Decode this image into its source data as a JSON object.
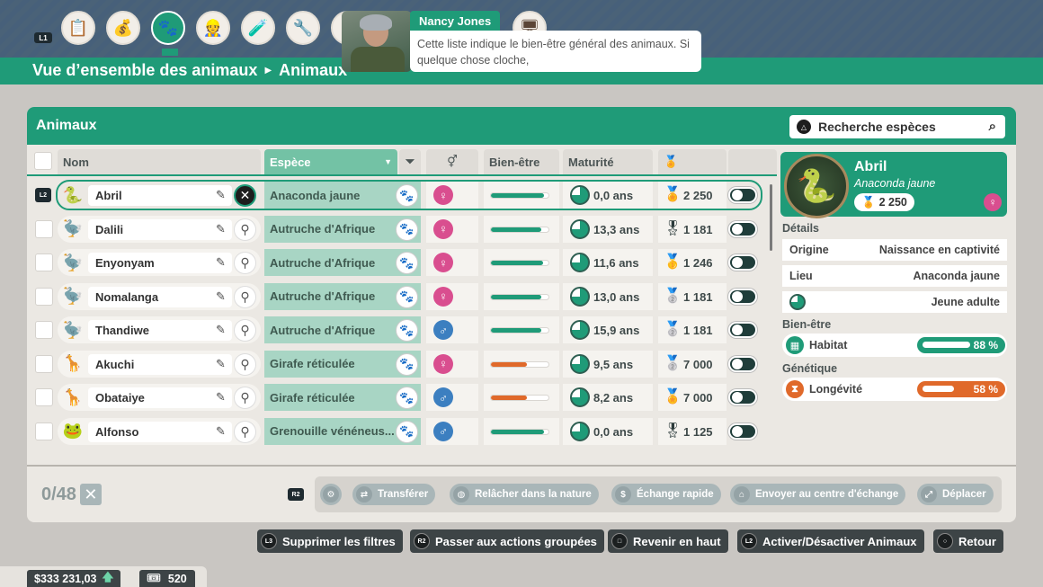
{
  "nav": {
    "l1_label": "L1",
    "icons": [
      "clipboard-icon",
      "money-icon",
      "paw-icon",
      "staff-icon",
      "research-icon",
      "wrench-icon",
      "hidden-icon",
      "presentation-icon"
    ],
    "active_index": 2
  },
  "breadcrumb": {
    "level1": "Vue d’ensemble des animaux",
    "level2": "Animaux"
  },
  "advisor": {
    "name": "Nancy Jones",
    "message": "Cette liste indique le bien-être général des animaux. Si quelque chose cloche,"
  },
  "panel": {
    "title": "Animaux",
    "search_placeholder": "Recherche espèces",
    "columns": {
      "name": "Nom",
      "species": "Espèce",
      "welfare": "Bien-être",
      "maturity": "Maturité"
    }
  },
  "colors": {
    "accent": "#1f9b78",
    "female": "#d94e8f",
    "male": "#3c7fc0",
    "welfare_good": "#1f9b78",
    "welfare_mid": "#e0692a"
  },
  "animals": [
    {
      "name": "Abril",
      "species": "Anaconda jaune",
      "gender": "f",
      "welfare": 0.92,
      "welfare_color": "#1f9b78",
      "maturity": "0,0 ans",
      "score": "2 250",
      "medal": "bronze",
      "thumb": "🐍",
      "selected": true
    },
    {
      "name": "Dalili",
      "species": "Autruche d'Afrique",
      "gender": "f",
      "welfare": 0.88,
      "welfare_color": "#1f9b78",
      "maturity": "13,3 ans",
      "score": "1 181",
      "medal": "bronze-outline",
      "thumb": "🦤"
    },
    {
      "name": "Enyonyam",
      "species": "Autruche d'Afrique",
      "gender": "f",
      "welfare": 0.9,
      "welfare_color": "#1f9b78",
      "maturity": "11,6 ans",
      "score": "1 246",
      "medal": "gold",
      "thumb": "🦤"
    },
    {
      "name": "Nomalanga",
      "species": "Autruche d'Afrique",
      "gender": "f",
      "welfare": 0.88,
      "welfare_color": "#1f9b78",
      "maturity": "13,0 ans",
      "score": "1 181",
      "medal": "silver",
      "thumb": "🦤"
    },
    {
      "name": "Thandiwe",
      "species": "Autruche d'Afrique",
      "gender": "m",
      "welfare": 0.88,
      "welfare_color": "#1f9b78",
      "maturity": "15,9 ans",
      "score": "1 181",
      "medal": "silver",
      "thumb": "🦤"
    },
    {
      "name": "Akuchi",
      "species": "Girafe réticulée",
      "gender": "f",
      "welfare": 0.62,
      "welfare_color": "#e0692a",
      "maturity": "9,5 ans",
      "score": "7 000",
      "medal": "silver",
      "thumb": "🦒"
    },
    {
      "name": "Obataiye",
      "species": "Girafe réticulée",
      "gender": "m",
      "welfare": 0.62,
      "welfare_color": "#e0692a",
      "maturity": "8,2 ans",
      "score": "7 000",
      "medal": "bronze",
      "thumb": "🦒"
    },
    {
      "name": "Alfonso",
      "species": "Grenouille vénéneus...",
      "gender": "m",
      "welfare": 0.92,
      "welfare_color": "#1f9b78",
      "maturity": "0,0 ans",
      "score": "1 125",
      "medal": "bronze-outline",
      "thumb": "🐸"
    }
  ],
  "detail": {
    "name": "Abril",
    "species": "Anaconda jaune",
    "score": "2 250",
    "section_details": "Détails",
    "origin_label": "Origine",
    "origin_value": "Naissance en captivité",
    "location_label": "Lieu",
    "location_value": "Anaconda jaune",
    "age_value": "Jeune adulte",
    "section_welfare": "Bien-être",
    "habitat_label": "Habitat",
    "habitat_pct": "88 %",
    "habitat_fill": 0.88,
    "section_genetics": "Génétique",
    "longevity_label": "Longévité",
    "longevity_pct": "58 %",
    "longevity_fill": 0.58
  },
  "footer": {
    "counter": "0/48",
    "r2": "R2",
    "actions": [
      "Transférer",
      "Relâcher dans la nature",
      "Échange rapide",
      "Envoyer au centre d'échange",
      "Déplacer"
    ]
  },
  "hints": [
    {
      "key": "L3",
      "label": "Supprimer les filtres"
    },
    {
      "key": "R2",
      "label": "Passer aux actions groupées"
    },
    {
      "key": "□",
      "label": "Revenir en haut"
    },
    {
      "key": "L2",
      "label": "Activer/Désactiver Animaux"
    },
    {
      "key": "○",
      "label": "Retour"
    }
  ],
  "status": {
    "money": "$333 231,03",
    "tickets": "520"
  }
}
